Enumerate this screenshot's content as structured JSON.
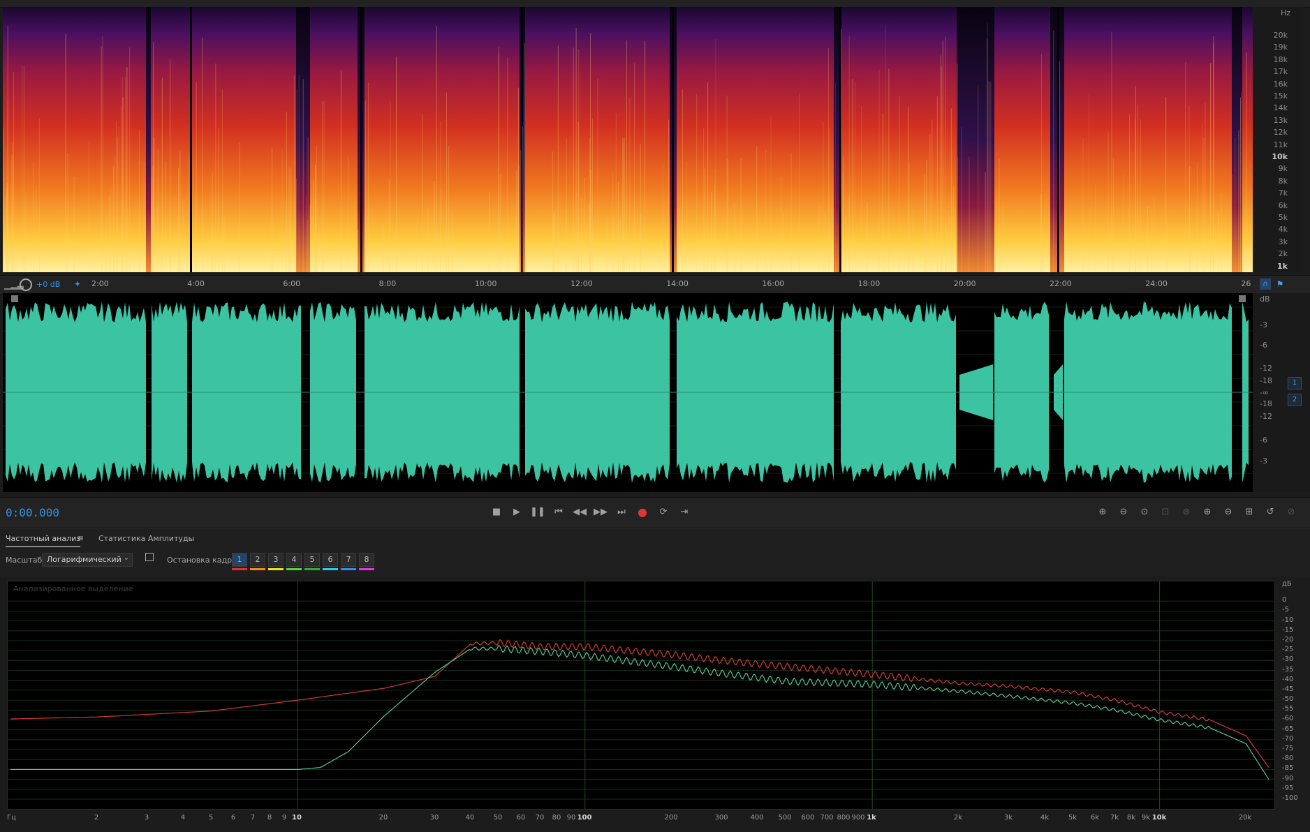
{
  "colors": {
    "waveform": "#3cc4a2",
    "accent": "#3b8fe4",
    "curve_red": "#d23a34",
    "curve_green": "#58c48f",
    "record": "#e23636"
  },
  "spectral": {
    "unit_label": "Hz",
    "freq_labels": [
      "20k",
      "19k",
      "18k",
      "17k",
      "16k",
      "15k",
      "14k",
      "13k",
      "12k",
      "11k",
      "10k",
      "9k",
      "8k",
      "7k",
      "6k",
      "5k",
      "4k",
      "3k",
      "2k",
      "1k"
    ]
  },
  "ruler": {
    "gain_label": "+0 dB",
    "time_labels": [
      "2:00",
      "4:00",
      "6:00",
      "8:00",
      "10:00",
      "12:00",
      "14:00",
      "16:00",
      "18:00",
      "20:00",
      "22:00",
      "24:00",
      "26"
    ]
  },
  "waveform": {
    "unit_label": "dB",
    "db_labels_top": [
      "-3",
      "-6",
      "-12",
      "-18"
    ],
    "center_label": "-∞",
    "db_labels_bottom": [
      "-18",
      "-12",
      "-6",
      "-3"
    ],
    "channels": [
      "1",
      "2"
    ]
  },
  "transport": {
    "time": "0:00.000",
    "buttons": [
      "stop-icon",
      "play-icon",
      "pause-icon",
      "goto-start-icon",
      "rewind-icon",
      "fast-forward-icon",
      "goto-end-icon",
      "record-icon",
      "loop-icon",
      "skip-icon"
    ],
    "zoom_buttons": [
      "zoom-in-amplitude-icon",
      "zoom-out-amplitude-icon",
      "zoom-reset-icon",
      "zoom-selection-icon",
      "zoom-fit-icon",
      "zoom-in-time-icon",
      "zoom-out-time-icon",
      "zoom-full-icon",
      "zoom-history-icon",
      "zoom-other-icon"
    ]
  },
  "panel": {
    "tab_active": "Частотный анализ",
    "tab_other": "Статистика Амплитуды",
    "scale_label": "Масштаб:",
    "scale_value": "Логарифмический",
    "freeze_label": "Остановка кадра:",
    "freeze_buttons": [
      "1",
      "2",
      "3",
      "4",
      "5",
      "6",
      "7",
      "8"
    ],
    "freeze_colors": [
      "#e0302a",
      "#f08a24",
      "#e8e02a",
      "#5ad43a",
      "#3aa83a",
      "#2ad0e0",
      "#3a8ae8",
      "#e03ad8"
    ]
  },
  "chart_data": {
    "type": "line",
    "title": "Анализированное выделение",
    "xlabel": "Гц",
    "ylabel": "дБ",
    "x_scale": "log",
    "xlim": [
      1,
      24000
    ],
    "ylim": [
      -100,
      5
    ],
    "x_ticks": [
      "2",
      "3",
      "4",
      "5",
      "6",
      "7",
      "8",
      "9",
      "10",
      "20",
      "30",
      "40",
      "50",
      "60",
      "70",
      "80",
      "90",
      "100",
      "200",
      "300",
      "400",
      "500",
      "600",
      "700",
      "800",
      "900",
      "1k",
      "2k",
      "3k",
      "4k",
      "5k",
      "6k",
      "7k",
      "8k",
      "9k",
      "10k",
      "20k"
    ],
    "y_ticks": [
      "0",
      "-5",
      "-10",
      "-15",
      "-20",
      "-25",
      "-30",
      "-35",
      "-40",
      "-45",
      "-50",
      "-55",
      "-60",
      "-65",
      "-70",
      "-75",
      "-80",
      "-85",
      "-90",
      "-95",
      "-100"
    ],
    "series": [
      {
        "color": "#d23a34",
        "x": [
          1,
          2,
          5,
          10,
          20,
          30,
          40,
          50,
          70,
          100,
          200,
          300,
          500,
          1000,
          2000,
          3000,
          5000,
          7000,
          10000,
          15000,
          20000,
          24000
        ],
        "y": [
          -59.5,
          -58.5,
          -55.5,
          -50,
          -44,
          -38,
          -21.5,
          -21,
          -23,
          -23,
          -27,
          -30,
          -33,
          -37,
          -41.5,
          -43,
          -46,
          -50,
          -56,
          -60,
          -68,
          -84
        ]
      },
      {
        "color": "#58c48f",
        "x": [
          1,
          5,
          10,
          12,
          15,
          20,
          30,
          40,
          50,
          70,
          100,
          200,
          300,
          500,
          1000,
          2000,
          3000,
          5000,
          7000,
          10000,
          15000,
          20000,
          24000
        ],
        "y": [
          -85,
          -85,
          -85,
          -84,
          -76,
          -58,
          -36,
          -24,
          -24,
          -25.5,
          -27.5,
          -33,
          -36.5,
          -40.5,
          -42,
          -45.5,
          -48,
          -51.5,
          -55,
          -60,
          -64,
          -72,
          -90
        ]
      }
    ]
  }
}
